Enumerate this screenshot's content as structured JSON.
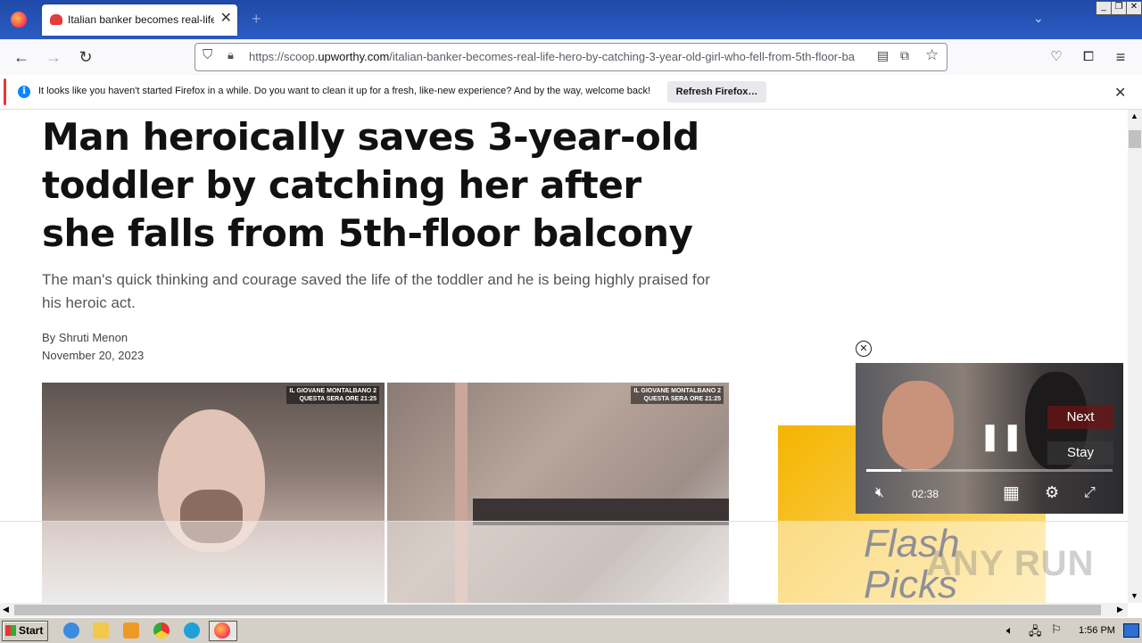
{
  "browser": {
    "tab_title": "Italian banker becomes real-life hero",
    "url_prefix": "https://scoop.",
    "url_domain": "upworthy.com",
    "url_path": "/italian-banker-becomes-real-life-hero-by-catching-3-year-old-girl-who-fell-from-5th-floor-ba"
  },
  "notification": {
    "text": "It looks like you haven't started Firefox in a while. Do you want to clean it up for a fresh, like-new experience? And by the way, welcome back!",
    "button_label": "Refresh Firefox…"
  },
  "article": {
    "headline": "Man heroically saves 3-year-old toddler by catching her after she falls from 5th-floor balcony",
    "subhead": "The man's quick thinking and courage saved the life of the toddler and he is being highly praised for his heroic act.",
    "byline": "By Shruti Menon",
    "date": "November 20, 2023",
    "image_caption_line1": "IL GIOVANE MONTALBANO 2",
    "image_caption_line2": "QUESTA SERA ORE 21:25"
  },
  "ad": {
    "text_line1": "Flash",
    "text_line2": "Picks"
  },
  "video": {
    "next_label": "Next",
    "stay_label": "Stay",
    "time": "02:38",
    "progress": 0.14
  },
  "taskbar": {
    "start_label": "Start",
    "clock": "1:56 PM"
  },
  "watermark": "ANY RUN"
}
